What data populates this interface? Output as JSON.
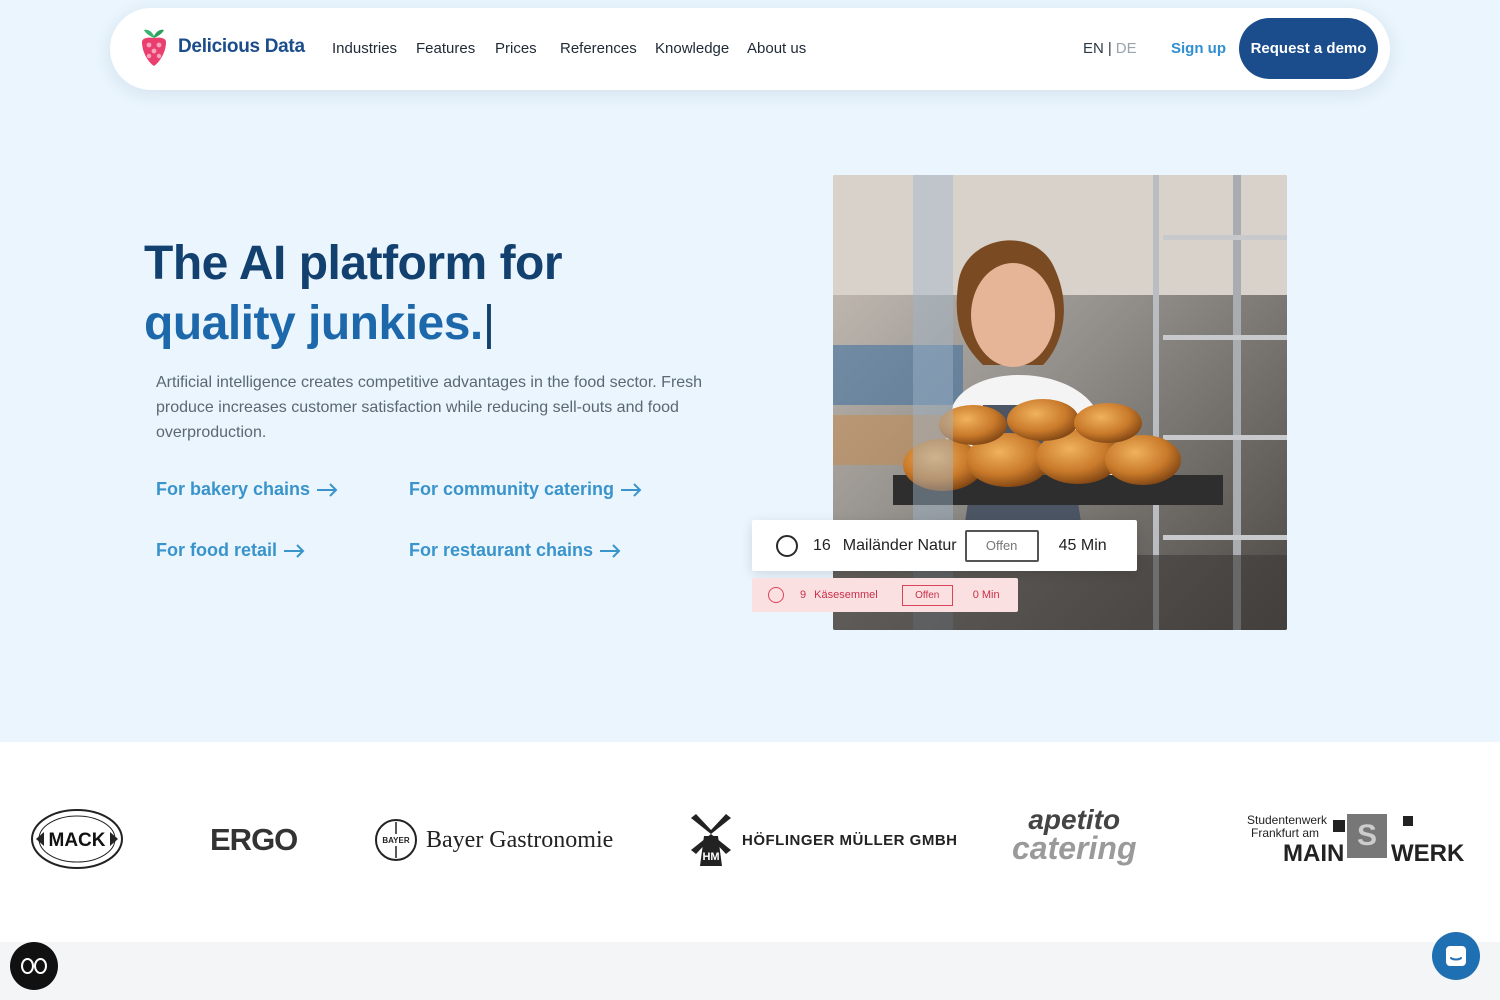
{
  "brand": {
    "name": "Delicious Data"
  },
  "nav": {
    "items": [
      {
        "label": "Industries"
      },
      {
        "label": "Features"
      },
      {
        "label": "Prices"
      },
      {
        "label": "References"
      },
      {
        "label": "Knowledge"
      },
      {
        "label": "About us"
      }
    ],
    "lang_en": "EN",
    "lang_sep": "|",
    "lang_de": "DE",
    "signup": "Sign up",
    "demo": "Request a demo"
  },
  "hero": {
    "title_line1": "The AI platform for",
    "title_line2": "quality junkies.",
    "caret": "|",
    "subtitle": "Artificial intelligence creates competitive advantages in the food sector. Fresh produce increases customer satisfaction while reducing sell-outs and food overproduction.",
    "links": [
      {
        "label": "For bakery chains"
      },
      {
        "label": "For community catering"
      },
      {
        "label": "For food retail"
      },
      {
        "label": "For restaurant chains"
      }
    ]
  },
  "order_cards": [
    {
      "number": "16",
      "product": "Mailänder Natur",
      "status": "Offen",
      "time": "45 Min"
    },
    {
      "number": "9",
      "product": "Käsesemmel",
      "status": "Offen",
      "time": "0 Min"
    }
  ],
  "clients": {
    "mack": "MACK",
    "ergo": "ERGO",
    "bayer": "Bayer Gastronomie",
    "bayer_mark": "BAYER",
    "hoeflinger": "HÖFLINGER MÜLLER GMBH",
    "hoeflinger_mark": "HM",
    "apetito_line1": "apetito",
    "apetito_line2": "catering",
    "mainwerk_line1": "Studentenwerk",
    "mainwerk_line2": "Frankfurt am",
    "mainwerk_main": "MAIN",
    "mainwerk_s": "S",
    "mainwerk_werk": "WERK"
  },
  "colors": {
    "primary": "#1b4d8c",
    "accent": "#3a94cc",
    "hero_bg": "#eaf5fd",
    "alert": "#d9445a"
  }
}
